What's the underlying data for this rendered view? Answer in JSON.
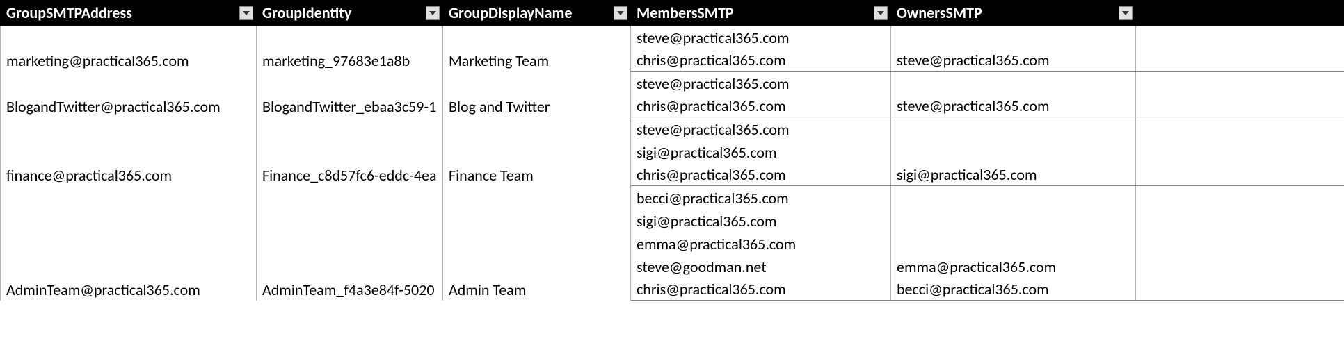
{
  "columns": [
    {
      "key": "GroupSMTPAddress",
      "label": "GroupSMTPAddress"
    },
    {
      "key": "GroupIdentity",
      "label": "GroupIdentity"
    },
    {
      "key": "GroupDisplayName",
      "label": "GroupDisplayName"
    },
    {
      "key": "MembersSMTP",
      "label": "MembersSMTP"
    },
    {
      "key": "OwnersSMTP",
      "label": "OwnersSMTP"
    }
  ],
  "rows": [
    {
      "GroupSMTPAddress": "marketing@practical365.com",
      "GroupIdentity": "marketing_97683e1a8b",
      "GroupDisplayName": "Marketing Team",
      "MembersSMTP": [
        "steve@practical365.com",
        "chris@practical365.com"
      ],
      "OwnersSMTP": [
        "steve@practical365.com"
      ]
    },
    {
      "GroupSMTPAddress": "BlogandTwitter@practical365.com",
      "GroupIdentity": "BlogandTwitter_ebaa3c59-1",
      "GroupDisplayName": "Blog and Twitter",
      "MembersSMTP": [
        "steve@practical365.com",
        "chris@practical365.com"
      ],
      "OwnersSMTP": [
        "steve@practical365.com"
      ]
    },
    {
      "GroupSMTPAddress": "finance@practical365.com",
      "GroupIdentity": "Finance_c8d57fc6-eddc-4ea",
      "GroupDisplayName": "Finance Team",
      "MembersSMTP": [
        "steve@practical365.com",
        "sigi@practical365.com",
        "chris@practical365.com"
      ],
      "OwnersSMTP": [
        "sigi@practical365.com"
      ]
    },
    {
      "GroupSMTPAddress": "AdminTeam@practical365.com",
      "GroupIdentity": "AdminTeam_f4a3e84f-5020",
      "GroupDisplayName": "Admin Team",
      "MembersSMTP": [
        "becci@practical365.com",
        "sigi@practical365.com",
        "emma@practical365.com",
        "steve@goodman.net",
        "chris@practical365.com"
      ],
      "OwnersSMTP": [
        "emma@practical365.com",
        "becci@practical365.com"
      ]
    }
  ]
}
